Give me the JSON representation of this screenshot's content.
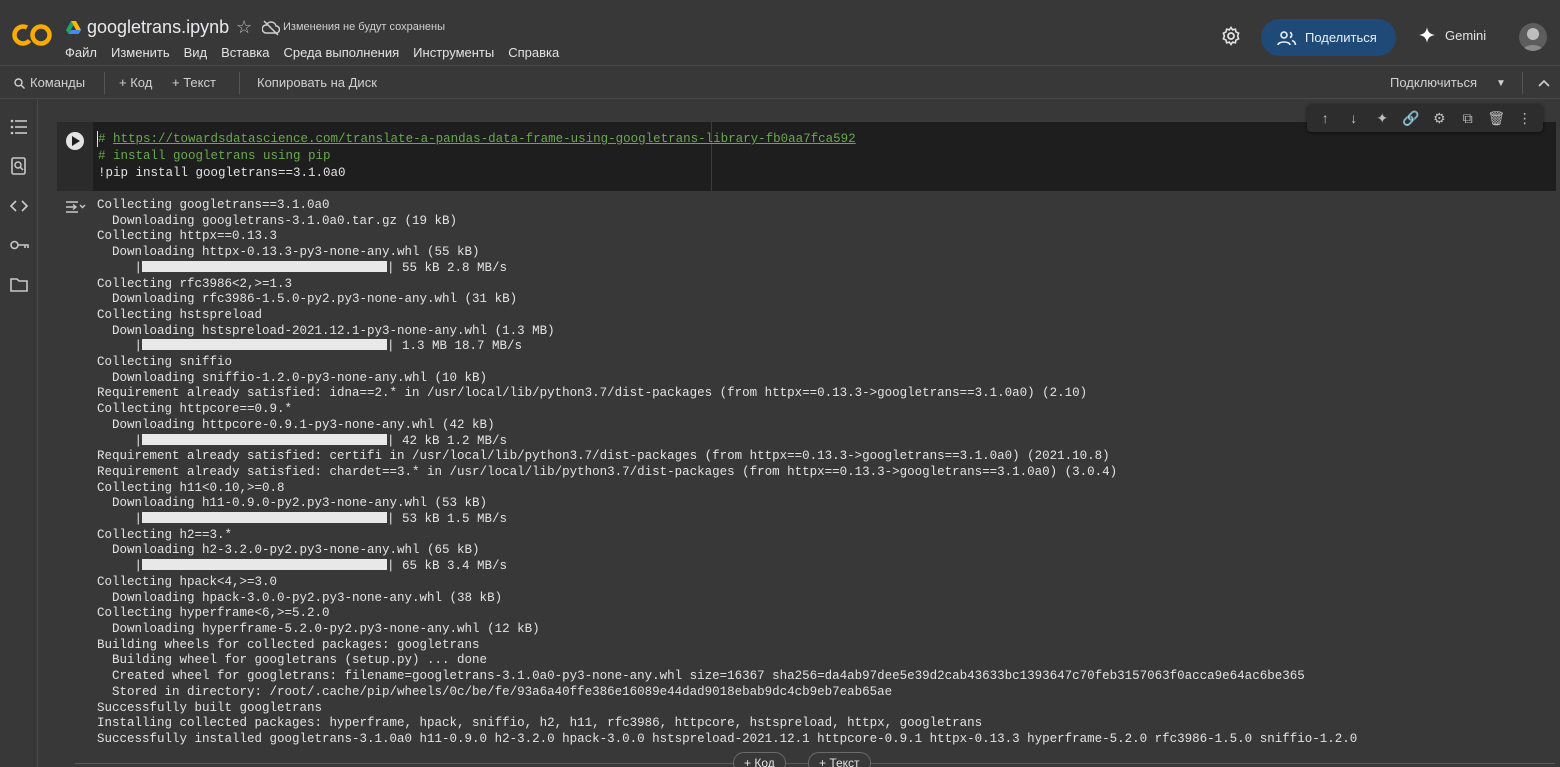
{
  "header": {
    "title": "googletrans.ipynb",
    "unsaved": "Изменения не будут сохранены",
    "menu": [
      "Файл",
      "Изменить",
      "Вид",
      "Вставка",
      "Среда выполнения",
      "Инструменты",
      "Справка"
    ],
    "share_label": "Поделиться",
    "gemini_label": "Gemini",
    "logo_text": "CO"
  },
  "toolbar": {
    "commands": "Команды",
    "add_code": "+ Код",
    "add_text": "+ Текст",
    "copy_to_drive": "Копировать на Диск",
    "connect": "Подключиться"
  },
  "cell": {
    "line1_hash": "# ",
    "line1_url": "https://towardsdatascience.com/translate-a-pandas-data-frame-using-googletrans-library-fb0aa7fca592",
    "line2": "# install googletrans using pip",
    "line3": "!pip install googletrans==3.1.0a0"
  },
  "output": {
    "lines": [
      {
        "text": "Collecting googletrans==3.1.0a0"
      },
      {
        "text": "  Downloading googletrans-3.1.0a0.tar.gz (19 kB)"
      },
      {
        "text": "Collecting httpx==0.13.3"
      },
      {
        "text": "  Downloading httpx-0.13.3-py3-none-any.whl (55 kB)"
      },
      {
        "bar": true,
        "text": "| 55 kB 2.8 MB/s"
      },
      {
        "text": "Collecting rfc3986<2,>=1.3"
      },
      {
        "text": "  Downloading rfc3986-1.5.0-py2.py3-none-any.whl (31 kB)"
      },
      {
        "text": "Collecting hstspreload"
      },
      {
        "text": "  Downloading hstspreload-2021.12.1-py3-none-any.whl (1.3 MB)"
      },
      {
        "bar": true,
        "text": "| 1.3 MB 18.7 MB/s"
      },
      {
        "text": "Collecting sniffio"
      },
      {
        "text": "  Downloading sniffio-1.2.0-py3-none-any.whl (10 kB)"
      },
      {
        "text": "Requirement already satisfied: idna==2.* in /usr/local/lib/python3.7/dist-packages (from httpx==0.13.3->googletrans==3.1.0a0) (2.10)"
      },
      {
        "text": "Collecting httpcore==0.9.*"
      },
      {
        "text": "  Downloading httpcore-0.9.1-py3-none-any.whl (42 kB)"
      },
      {
        "bar": true,
        "text": "| 42 kB 1.2 MB/s"
      },
      {
        "text": "Requirement already satisfied: certifi in /usr/local/lib/python3.7/dist-packages (from httpx==0.13.3->googletrans==3.1.0a0) (2021.10.8)"
      },
      {
        "text": "Requirement already satisfied: chardet==3.* in /usr/local/lib/python3.7/dist-packages (from httpx==0.13.3->googletrans==3.1.0a0) (3.0.4)"
      },
      {
        "text": "Collecting h11<0.10,>=0.8"
      },
      {
        "text": "  Downloading h11-0.9.0-py2.py3-none-any.whl (53 kB)"
      },
      {
        "bar": true,
        "text": "| 53 kB 1.5 MB/s"
      },
      {
        "text": "Collecting h2==3.*"
      },
      {
        "text": "  Downloading h2-3.2.0-py2.py3-none-any.whl (65 kB)"
      },
      {
        "bar": true,
        "text": "| 65 kB 3.4 MB/s"
      },
      {
        "text": "Collecting hpack<4,>=3.0"
      },
      {
        "text": "  Downloading hpack-3.0.0-py2.py3-none-any.whl (38 kB)"
      },
      {
        "text": "Collecting hyperframe<6,>=5.2.0"
      },
      {
        "text": "  Downloading hyperframe-5.2.0-py2.py3-none-any.whl (12 kB)"
      },
      {
        "text": "Building wheels for collected packages: googletrans"
      },
      {
        "text": "  Building wheel for googletrans (setup.py) ... done"
      },
      {
        "text": "  Created wheel for googletrans: filename=googletrans-3.1.0a0-py3-none-any.whl size=16367 sha256=da4ab97dee5e39d2cab43633bc1393647c70feb3157063f0acca9e64ac6be365"
      },
      {
        "text": "  Stored in directory: /root/.cache/pip/wheels/0c/be/fe/93a6a40ffe386e16089e44dad9018ebab9dc4cb9eb7eab65ae"
      },
      {
        "text": "Successfully built googletrans"
      },
      {
        "text": "Installing collected packages: hyperframe, hpack, sniffio, h2, h11, rfc3986, httpcore, hstspreload, httpx, googletrans"
      },
      {
        "text": "Successfully installed googletrans-3.1.0a0 h11-0.9.0 h2-3.2.0 hpack-3.0.0 hstspreload-2021.12.1 httpcore-0.9.1 httpx-0.13.3 hyperframe-5.2.0 rfc3986-1.5.0 sniffio-1.2.0"
      }
    ]
  },
  "bottom": {
    "add_code": "+ Код",
    "add_text": "+ Текст"
  },
  "colors": {
    "background": "#383838",
    "cell_bg": "#1e1e1e",
    "comment": "#6aa84f",
    "share_bg": "#1f4a78",
    "logo_orange": "#f9ab00"
  }
}
